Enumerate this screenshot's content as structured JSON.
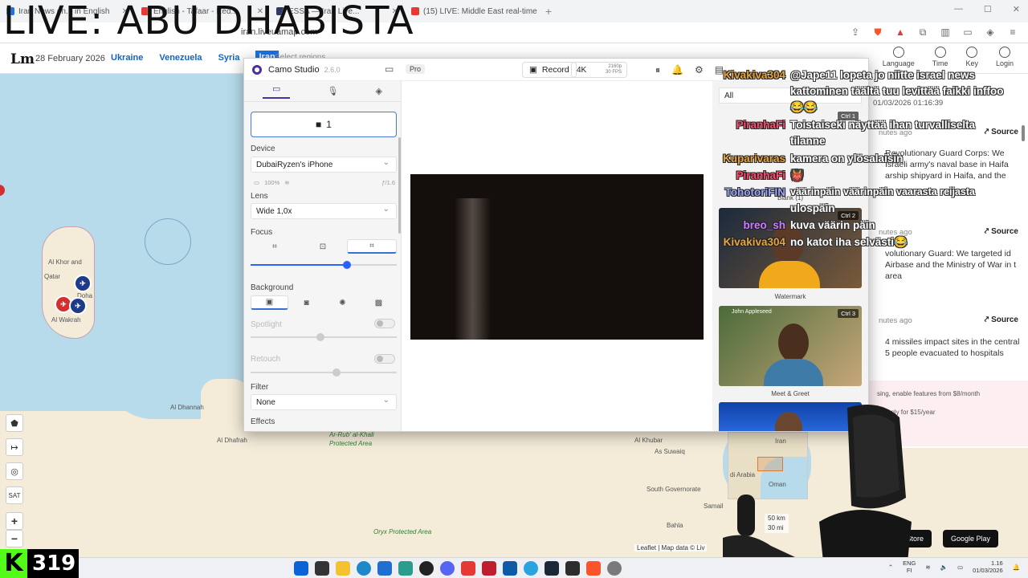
{
  "overlay_title": "LIVE: ABU DHABISTA",
  "browser": {
    "tabs": [
      {
        "label": "Iran News on...  in English",
        "color": "#1a73e8"
      },
      {
        "label": "English - Tafaar - Red...",
        "color": "#e53935"
      },
      {
        "label": "ESSA — Iran Live...",
        "color": "#2b3a67"
      },
      {
        "label": "(15) LIVE: Middle East real-time came...",
        "color": "#e53935"
      }
    ],
    "url": "iran.liveuamap.com"
  },
  "site": {
    "logo": "Lm",
    "date": "28 February 2026",
    "nav": [
      "Ukraine",
      "Venezuela",
      "Syria",
      "Iran"
    ],
    "select_regions": "Select regions",
    "top_right": [
      "Language",
      "Time",
      "Key",
      "Login"
    ]
  },
  "map": {
    "labels": [
      {
        "text": "Qatar",
        "green": false
      },
      {
        "text": "Doha",
        "green": false
      },
      {
        "text": "Al Khor and",
        "green": false
      },
      {
        "text": "Al Wakrah",
        "green": false
      },
      {
        "text": "Al Dhannah",
        "green": false
      },
      {
        "text": "Al Dhafrah",
        "green": false
      },
      {
        "text": "Ar-Rub' al-Khali",
        "green": true
      },
      {
        "text": "Protected Area",
        "green": true
      },
      {
        "text": "Al Khubar",
        "green": false
      },
      {
        "text": "As Suwaiq",
        "green": false
      },
      {
        "text": "South Governorate",
        "green": false
      },
      {
        "text": "Samail",
        "green": false
      },
      {
        "text": "Oryx Protected Area",
        "green": true
      },
      {
        "text": "Bahla",
        "green": false
      },
      {
        "text": "Iran",
        "green": false
      },
      {
        "text": "di Arabia",
        "green": false
      },
      {
        "text": "Oman",
        "green": false
      }
    ],
    "scale": [
      "50 km",
      "30 mi"
    ],
    "attribution": "Leaflet | Map data © Liv",
    "controls": [
      "pentagon",
      "arrows",
      "eye-off",
      "SAT",
      "+",
      "−"
    ]
  },
  "news": {
    "timestamp": "01/03/2026 01:16:39",
    "items": [
      {
        "ago": "nutes ago",
        "source": "Source",
        "text": "Revolutionary Guard Corps: We Israeli army's naval base in Haifa arship shipyard in Haifa, and the"
      },
      {
        "ago": "nutes ago",
        "source": "Source",
        "text": "volutionary Guard: We targeted id Airbase and the Ministry of War in t area"
      },
      {
        "ago": "nutes ago",
        "source": "Source",
        "text": "4 missiles impact sites in the central 5 people evacuated to hospitals"
      }
    ],
    "promo": [
      "sing, enable features from $8/month",
      "ing only for $15/year"
    ],
    "app_store": "App Store",
    "google_play": "Google Play"
  },
  "camo": {
    "title": "Camo Studio",
    "version": "2.6.0",
    "pro": "Pro",
    "record": "Record",
    "res": "4K",
    "res_detail": [
      "2160p",
      "30 FPS"
    ],
    "camera_button": "1",
    "device_label": "Device",
    "device_value": "DubaiRyzen's iPhone",
    "battery": "100%",
    "aperture": "ƒ/1.6",
    "lens_label": "Lens",
    "lens_value": "Wide 1,0x",
    "focus_label": "Focus",
    "focus_value": 0.66,
    "background_label": "Background",
    "spotlight_label": "Spotlight",
    "spotlight_value": 0.48,
    "retouch_label": "Retouch",
    "retouch_value": 0.59,
    "filter_label": "Filter",
    "filter_value": "None",
    "effects_label": "Effects",
    "overlay_filter": "All",
    "overlays": [
      {
        "caption": "Blank (1)",
        "ctrl": "Ctrl 1"
      },
      {
        "caption": "Watermark",
        "ctrl": "Ctrl 2"
      },
      {
        "caption": "Meet & Greet",
        "ctrl": "Ctrl 3"
      }
    ],
    "meet_name": "John Appleseed"
  },
  "chat": [
    {
      "user": "Kivakiva304",
      "user_color": "#e8a33c",
      "msg": "@Jape11 lopeta jo niitte israel news"
    },
    {
      "user": "",
      "user_color": "#ffffff",
      "msg": "kattominen täältä tuu levittää faikki inffoo"
    },
    {
      "user": "",
      "user_color": "#ffffff",
      "msg": "😂😂"
    },
    {
      "user": "PiranhaFi",
      "user_color": "#ff4d6d",
      "msg": "Toistaiseki näyttää ihan turvalliselta"
    },
    {
      "user": "",
      "user_color": "#ffffff",
      "msg": "tilanne"
    },
    {
      "user": "Kuparivaras",
      "user_color": "#e8a33c",
      "msg": "kamera on ylösalaisin"
    },
    {
      "user": "PiranhaFi",
      "user_color": "#ff4d6d",
      "msg": "👹"
    },
    {
      "user": "TohotoriFIN",
      "user_color": "#9aa8ff",
      "msg": "väärinpäin väärinpäin vaarasta reijasta"
    },
    {
      "user": "",
      "user_color": "#ffffff",
      "msg": "ulospäin"
    },
    {
      "user": "breo_sh",
      "user_color": "#c77dff",
      "msg": "kuva väärin päin"
    },
    {
      "user": "Kivakiva304",
      "user_color": "#e8a33c",
      "msg": "no katot iha selvästi😂"
    }
  ],
  "counter": {
    "icon": "K",
    "value": "319"
  },
  "taskbar": {
    "lang": [
      "ENG",
      "FI"
    ],
    "time": "1.16",
    "date": "01/03/2026"
  }
}
